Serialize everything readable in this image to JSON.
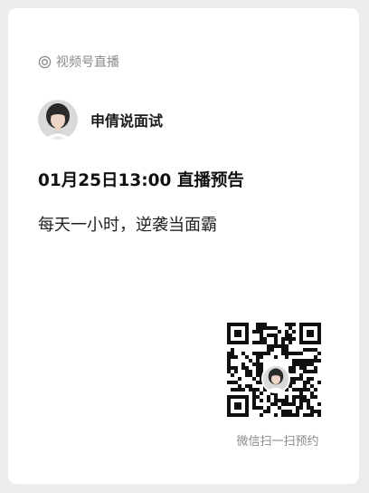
{
  "header": {
    "label": "视频号直播",
    "icon": "live-ring-icon"
  },
  "author": {
    "name": "申倩说面试",
    "avatar_icon": "avatar"
  },
  "live": {
    "title": "01月25日13:00 直播预告",
    "description": "每天一小时，逆袭当面霸"
  },
  "qr": {
    "icon": "qr-code-icon",
    "caption": "微信扫一扫预约"
  },
  "colors": {
    "background": "#ececec",
    "card": "#ffffff",
    "secondary_text": "#8a8a8a",
    "primary_text": "#111111"
  }
}
